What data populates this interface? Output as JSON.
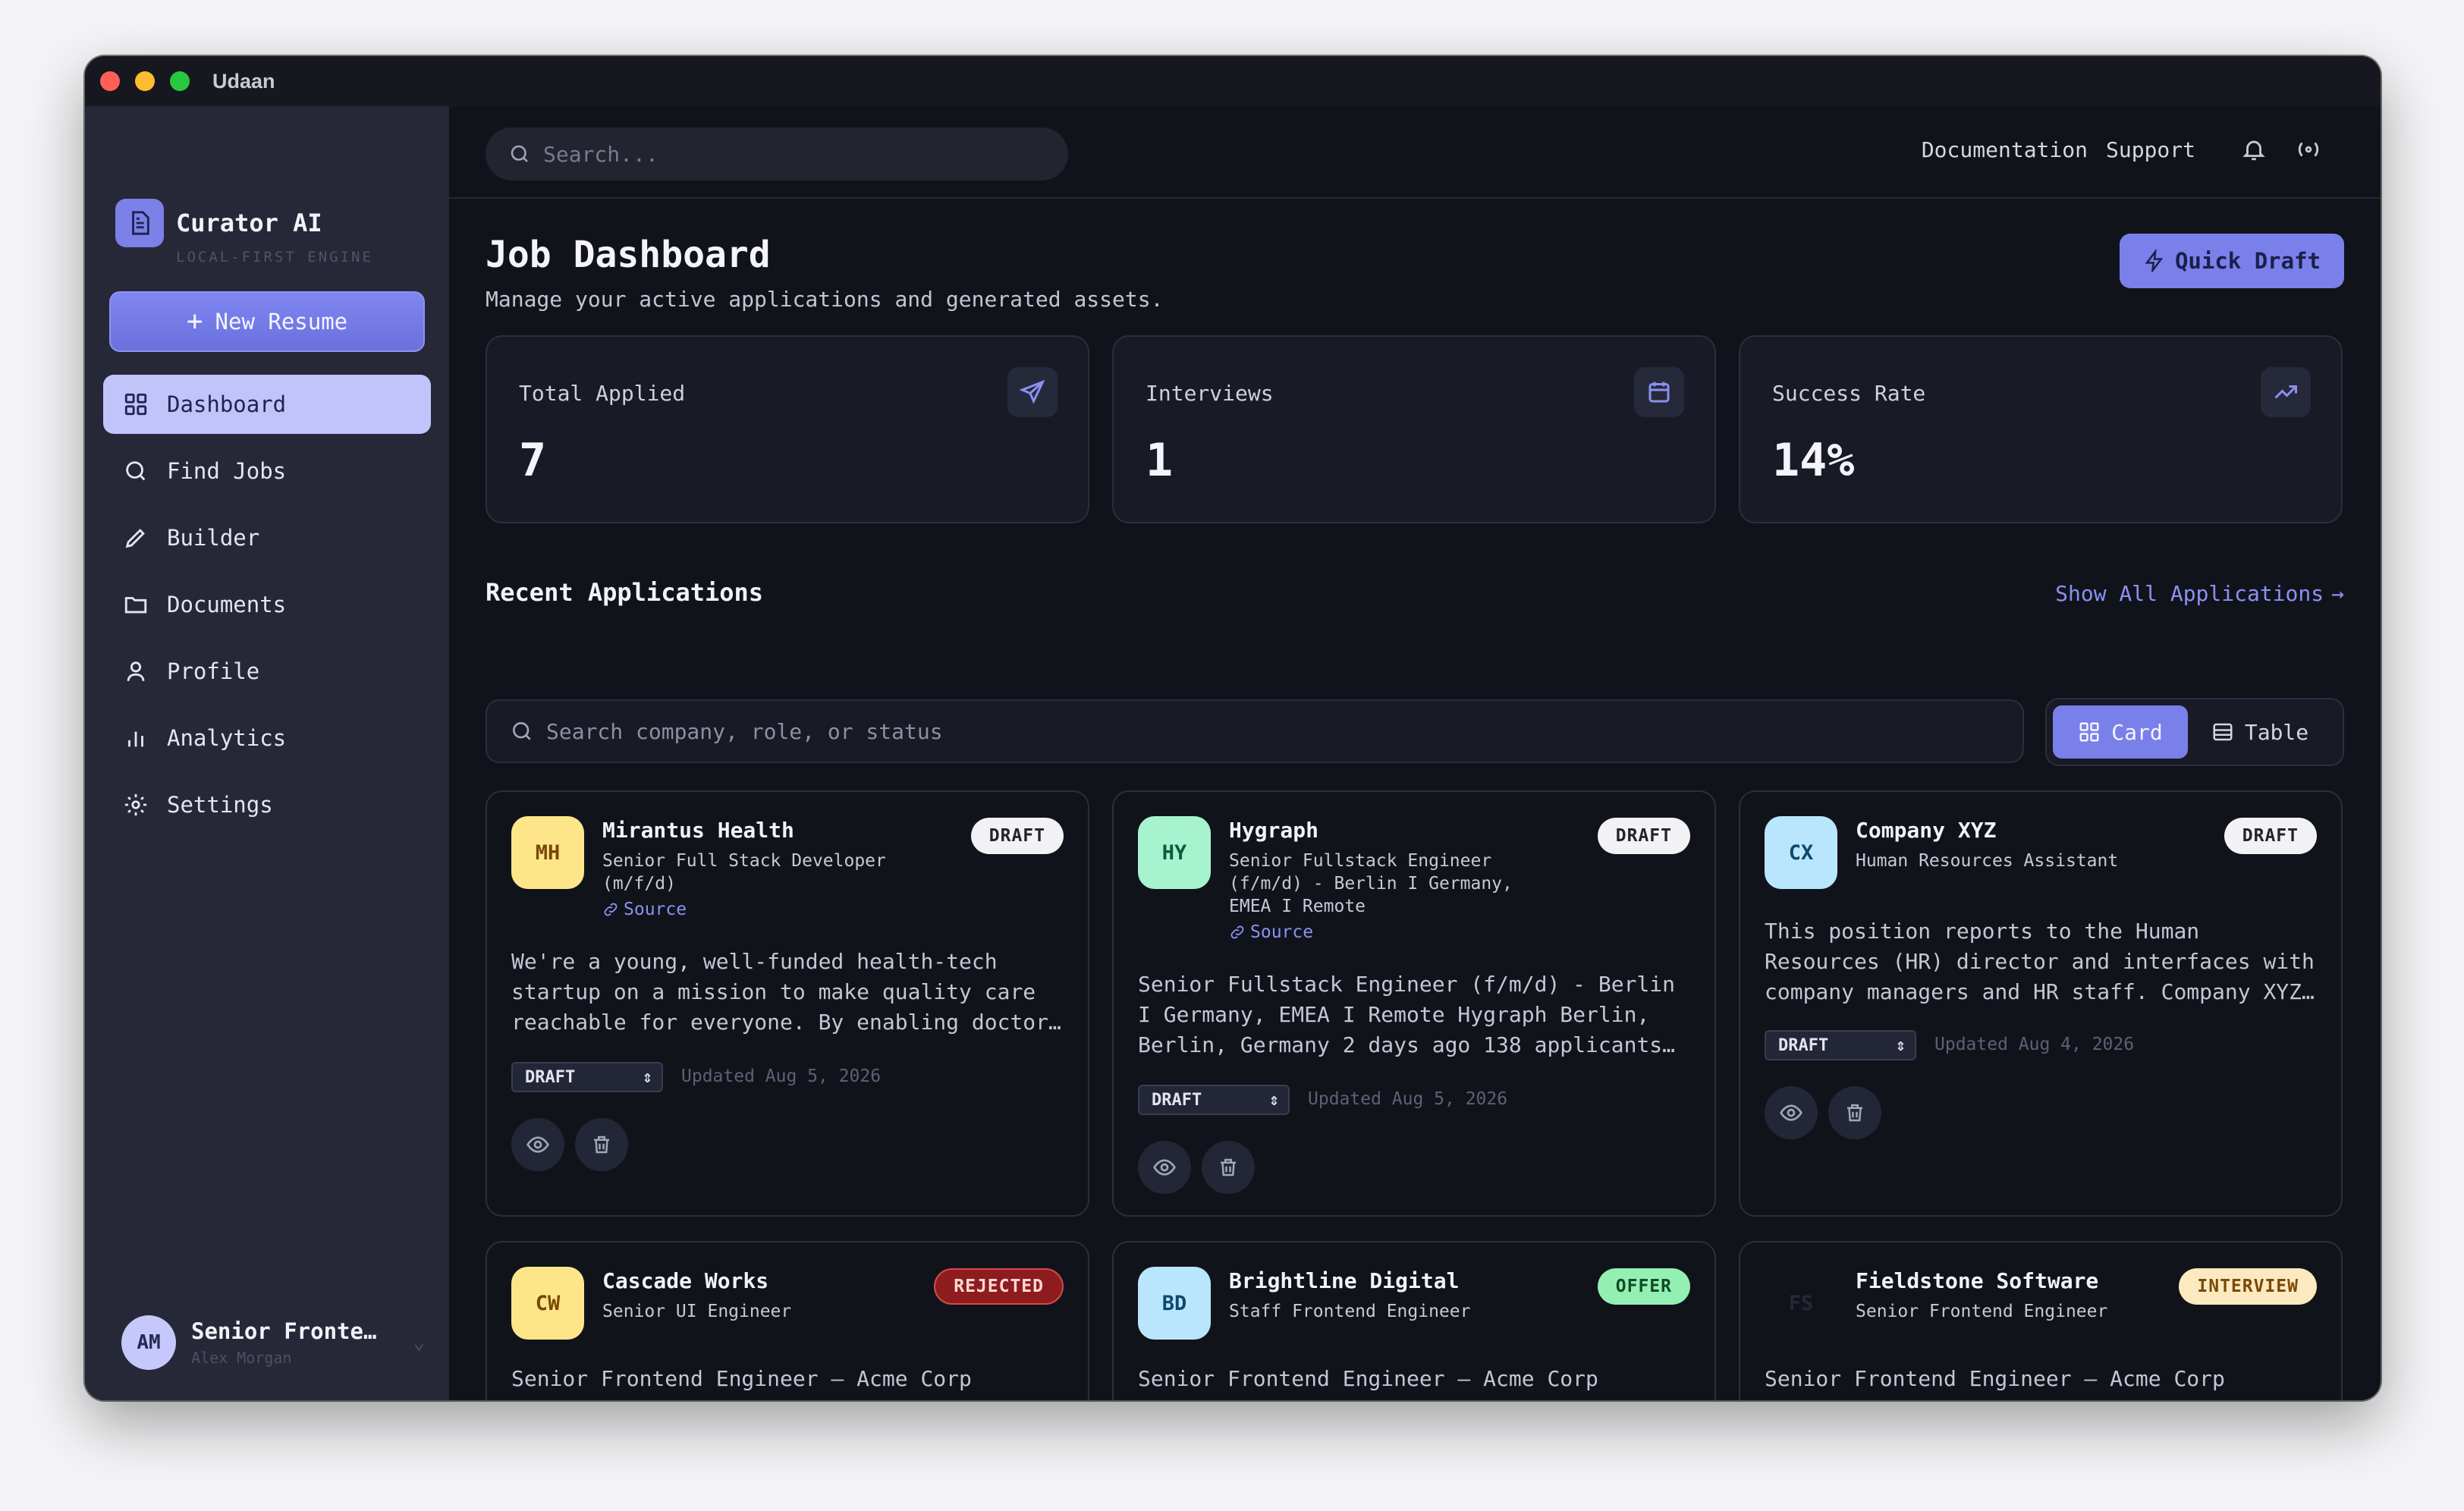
{
  "window": {
    "title": "Udaan"
  },
  "sidebar": {
    "brand_name": "Curator AI",
    "brand_sub": "LOCAL-FIRST ENGINE",
    "new_resume": "New Resume",
    "items": [
      {
        "label": "Dashboard",
        "icon": "grid-icon",
        "active": true
      },
      {
        "label": "Find Jobs",
        "icon": "search-icon"
      },
      {
        "label": "Builder",
        "icon": "pencil-icon"
      },
      {
        "label": "Documents",
        "icon": "folder-icon"
      },
      {
        "label": "Profile",
        "icon": "user-icon"
      },
      {
        "label": "Analytics",
        "icon": "bar-chart-icon"
      },
      {
        "label": "Settings",
        "icon": "gear-icon"
      }
    ],
    "user": {
      "initials": "AM",
      "role": "Senior Fronte…",
      "name": "Alex Morgan"
    }
  },
  "header": {
    "search_placeholder": "Search...",
    "links": [
      "Documentation",
      "Support"
    ]
  },
  "main": {
    "title": "Job Dashboard",
    "subtitle": "Manage your active applications and generated assets.",
    "quick_draft": "Quick Draft",
    "stats": [
      {
        "label": "Total Applied",
        "value": "7",
        "icon": "send-icon"
      },
      {
        "label": "Interviews",
        "value": "1",
        "icon": "calendar-icon"
      },
      {
        "label": "Success Rate",
        "value": "14%",
        "icon": "trending-up-icon"
      }
    ],
    "recent_title": "Recent Applications",
    "show_all": "Show All Applications",
    "filter_placeholder": "Search company, role, or status",
    "view_card": "Card",
    "view_table": "Table",
    "cards": [
      {
        "initials": "MH",
        "company": "Mirantus Health",
        "role": "Senior Full Stack Developer (m/f/d)",
        "source": "Source",
        "badge": "DRAFT",
        "desc": "We're a young, well-funded health-tech startup on a mission to make quality care reachable for everyone. By enabling doctor…",
        "status": "DRAFT",
        "updated": "Updated Aug 5, 2026"
      },
      {
        "initials": "HY",
        "company": "Hygraph",
        "role": "Senior Fullstack Engineer (f/m/d) - Berlin I Germany, EMEA I Remote",
        "source": "Source",
        "badge": "DRAFT",
        "desc": "Senior Fullstack Engineer (f/m/d) - Berlin I Germany, EMEA I Remote Hygraph Berlin, Berlin, Germany 2 days ago 138 applicants…",
        "status": "DRAFT",
        "updated": "Updated Aug 5, 2026"
      },
      {
        "initials": "CX",
        "company": "Company XYZ",
        "role": "Human Resources Assistant",
        "badge": "DRAFT",
        "desc": "This position reports to the Human Resources (HR) director and interfaces with company managers and HR staff. Company XYZ…",
        "status": "DRAFT",
        "updated": "Updated Aug 4, 2026"
      },
      {
        "initials": "CW",
        "company": "Cascade Works",
        "role": "Senior UI Engineer",
        "badge": "REJECTED",
        "desc": "Senior Frontend Engineer — Acme Corp (Remote) Acme Corp builds tools that help online retailers run their storefronts.…"
      },
      {
        "initials": "BD",
        "company": "Brightline Digital",
        "role": "Staff Frontend Engineer",
        "badge": "OFFER",
        "desc": "Senior Frontend Engineer — Acme Corp (Remote) Acme Corp builds tools that help online retailers run their storefronts.…"
      },
      {
        "initials": "FS",
        "company": "Fieldstone Software",
        "role": "Senior Frontend Engineer",
        "badge": "INTERVIEW",
        "desc": "Senior Frontend Engineer — Acme Corp (Remote) Acme Corp builds tools that help online retailers run their storefronts.…"
      }
    ]
  },
  "colors": {
    "accent": "#7a80ea",
    "sidebar_bg": "#262838",
    "app_bg": "#11131b"
  }
}
